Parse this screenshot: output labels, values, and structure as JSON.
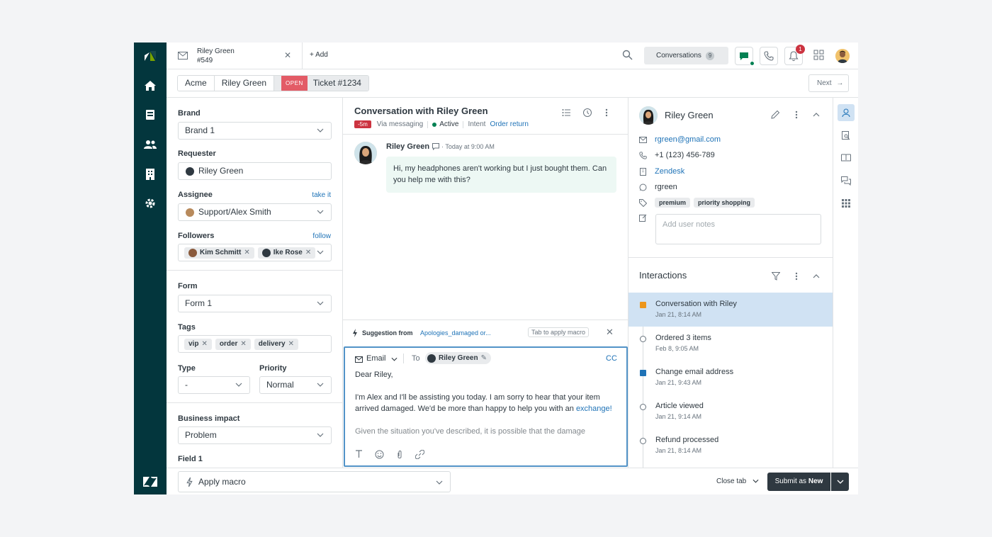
{
  "topbar": {
    "tab_name": "Riley Green",
    "tab_number": "#549",
    "add_label": "+ Add",
    "conversations_label": "Conversations",
    "conversations_count": "9",
    "notifications_count": "1"
  },
  "breadcrumb": {
    "org": "Acme",
    "requester": "Riley Green",
    "status": "OPEN",
    "ticket": "Ticket #1234",
    "next_label": "Next"
  },
  "ticket_fields": {
    "brand_label": "Brand",
    "brand_value": "Brand 1",
    "requester_label": "Requester",
    "requester_value": "Riley Green",
    "assignee_label": "Assignee",
    "assignee_link": "take it",
    "assignee_value": "Support/Alex Smith",
    "followers_label": "Followers",
    "followers_link": "follow",
    "followers": [
      "Kim Schmitt",
      "Ike Rose"
    ],
    "form_label": "Form",
    "form_value": "Form 1",
    "tags_label": "Tags",
    "tags": [
      "vip",
      "order",
      "delivery"
    ],
    "type_label": "Type",
    "type_value": "-",
    "priority_label": "Priority",
    "priority_value": "Normal",
    "impact_label": "Business impact",
    "impact_value": "Problem",
    "field1_label": "Field 1"
  },
  "conversation": {
    "title": "Conversation with Riley Green",
    "age": "-5m",
    "channel": "Via messaging",
    "status": "Active",
    "intent_label": "Intent",
    "intent_value": "Order return",
    "message_author": "Riley Green",
    "message_time": "Today at 9:00 AM",
    "message_text": "Hi, my headphones aren't working but I just bought them. Can you help me with this?"
  },
  "suggestion": {
    "label": "Suggestion from",
    "macro": "Apologies_damaged or...",
    "hint": "Tab to apply macro"
  },
  "composer": {
    "channel": "Email",
    "to_label": "To",
    "to_value": "Riley Green",
    "cc_label": "CC",
    "greeting": "Dear Riley,",
    "body": "I'm Alex and I'll be assisting you today. I am sorry to hear that your item arrived damaged. We'd be more than happy to help you with an",
    "body_link": "exchange!",
    "body_more": "Given the situation you've described, it is possible that the damage"
  },
  "customer": {
    "name": "Riley Green",
    "email": "rgreen@gmail.com",
    "phone": "+1 (123) 456-789",
    "org": "Zendesk",
    "whatsapp": "rgreen",
    "tags": [
      "premium",
      "priority shopping"
    ],
    "notes_placeholder": "Add user notes"
  },
  "interactions": {
    "title": "Interactions",
    "items": [
      {
        "title": "Conversation with Riley",
        "date": "Jan 21, 8:14 AM"
      },
      {
        "title": "Ordered 3 items",
        "date": "Feb 8, 9:05 AM"
      },
      {
        "title": "Change email address",
        "date": "Jan 21, 9:43 AM"
      },
      {
        "title": "Article viewed",
        "date": "Jan 21, 9:14 AM"
      },
      {
        "title": "Refund processed",
        "date": "Jan 21, 8:14 AM"
      }
    ]
  },
  "footer": {
    "macro_label": "Apply macro",
    "close_tab": "Close tab",
    "submit_prefix": "Submit as",
    "submit_status": "New"
  },
  "colors": {
    "nav_bg": "#03363d",
    "accent": "#1f73b7",
    "open_badge": "#e35b66",
    "active_interaction": "#d0e2f3",
    "submit_bg": "#2f3941"
  }
}
